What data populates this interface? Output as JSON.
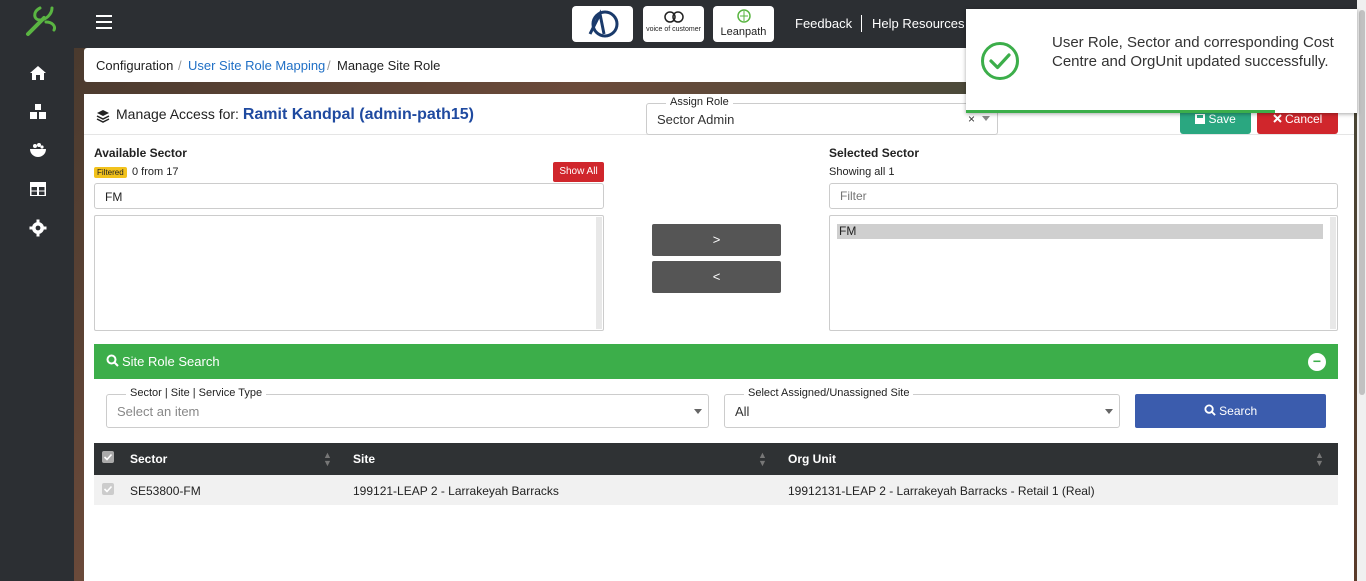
{
  "topbar": {
    "brands": [
      "AD",
      "voice of customer",
      "Leanpath"
    ],
    "links": [
      "Feedback",
      "Help Resources"
    ]
  },
  "sidebar": {
    "icons": [
      "home-icon",
      "boxes-icon",
      "bowl-icon",
      "table-icon",
      "gear-icon"
    ]
  },
  "breadcrumb": {
    "root": "Configuration",
    "parent": "User Site Role Mapping",
    "current": "Manage Site Role",
    "sep": "/"
  },
  "header": {
    "title_prefix": "Manage Access for:",
    "user": "Ramit Kandpal (admin-path15)",
    "assign_role_label": "Assign Role",
    "assign_role_value": "Sector Admin",
    "clear": "×",
    "save_label": "Save",
    "cancel_label": "Cancel"
  },
  "available": {
    "label": "Available Sector",
    "badge": "Filtered",
    "count": "0 from 17",
    "show_all": "Show All",
    "filter_value": "FM"
  },
  "selected": {
    "label": "Selected Sector",
    "count": "Showing all 1",
    "filter_placeholder": "Filter",
    "items": [
      "FM"
    ]
  },
  "move": {
    "right": ">",
    "left": "<"
  },
  "site_role_search": {
    "title": "Site Role Search",
    "collapse": "−",
    "sector_label": "Sector | Site | Service Type",
    "sector_placeholder": "Select an item",
    "assigned_label": "Select Assigned/Unassigned Site",
    "assigned_value": "All",
    "search_label": "Search"
  },
  "table": {
    "headers": [
      "Sector",
      "Site",
      "Org Unit"
    ],
    "rows": [
      {
        "sector": "SE53800-FM",
        "site": "199121-LEAP 2 - Larrakeyah Barracks",
        "org_unit": "19912131-LEAP 2 - Larrakeyah Barracks - Retail 1 (Real)"
      }
    ]
  },
  "toast": {
    "message": "User Role, Sector and corresponding Cost Centre and OrgUnit updated successfully."
  },
  "colors": {
    "sidebar": "#2c2f33",
    "success": "#3cae4a",
    "primary": "#3b5cad",
    "danger": "#d0262c",
    "save": "#2aa780",
    "link": "#1f6fc5"
  }
}
